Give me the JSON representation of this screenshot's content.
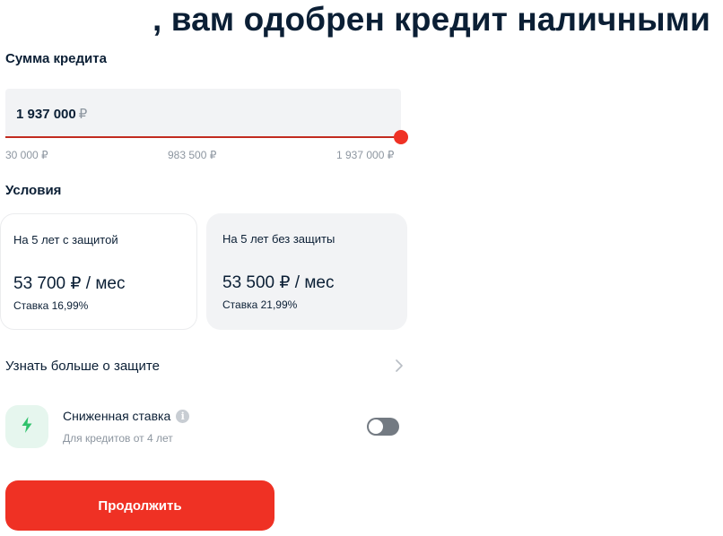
{
  "header": {
    "title": ", вам одобрен кредит наличными"
  },
  "amount_section": {
    "title": "Сумма кредита",
    "value": "1 937 000",
    "currency": "₽",
    "slider": {
      "min": 30000,
      "max": 1937000,
      "current": 1937000,
      "tick_labels": [
        "30 000 ₽",
        "983 500 ₽",
        "1 937 000 ₽"
      ]
    }
  },
  "conditions": {
    "title": "Условия",
    "options": [
      {
        "term": "На 5 лет с защитой",
        "payment": "53 700 ₽ / мес",
        "rate": "Ставка 16,99%",
        "selected": true
      },
      {
        "term": "На 5 лет без защиты",
        "payment": "53 500 ₽ / мес",
        "rate": "Ставка 21,99%",
        "selected": false
      }
    ]
  },
  "protection_link": {
    "label": "Узнать больше о защите",
    "icon": "chevron-right-icon"
  },
  "low_rate": {
    "title": "Сниженная ставка",
    "info_glyph": "i",
    "subtitle": "Для кредитов от 4 лет",
    "enabled": false,
    "icon": "lightning-icon",
    "icon_color": "#2fc26b"
  },
  "actions": {
    "continue_label": "Продолжить"
  },
  "colors": {
    "brand_red": "#ef3124",
    "slider_fill": "#c22b1f",
    "card_bg": "#f2f3f5",
    "muted_text": "#8d96a0",
    "toggle_off": "#737a82"
  }
}
